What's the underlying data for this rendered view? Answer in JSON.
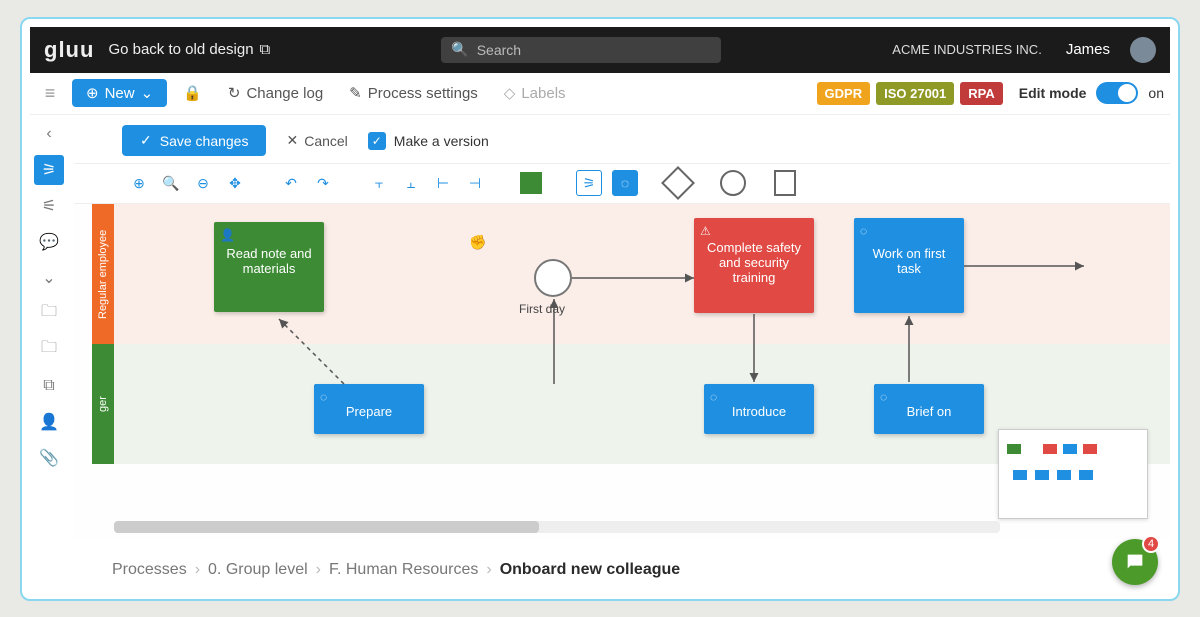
{
  "header": {
    "logo": "gluu",
    "back_link": "Go back to old design",
    "search_placeholder": "Search",
    "company": "ACME INDUSTRIES INC.",
    "user": "James"
  },
  "toolbar": {
    "new_label": "New",
    "change_log": "Change log",
    "process_settings": "Process settings",
    "labels": "Labels",
    "badges": {
      "gdpr": "GDPR",
      "iso": "ISO 27001",
      "rpa": "RPA"
    },
    "edit_mode_label": "Edit mode",
    "edit_mode_state": "on"
  },
  "actions": {
    "save": "Save changes",
    "cancel": "Cancel",
    "make_version": "Make a version"
  },
  "lanes": {
    "top": "Regular employee",
    "bottom": "ger"
  },
  "nodes": {
    "read_note": "Read note and materials",
    "first_day": "First day",
    "complete_safety": "Complete safety and security training",
    "work_first_task": "Work on first task",
    "prepare": "Prepare",
    "introduce": "Introduce",
    "brief_on": "Brief on"
  },
  "breadcrumb": {
    "a": "Processes",
    "b": "0. Group level",
    "c": "F. Human Resources",
    "d": "Onboard new colleague"
  },
  "chat_badge": "4"
}
